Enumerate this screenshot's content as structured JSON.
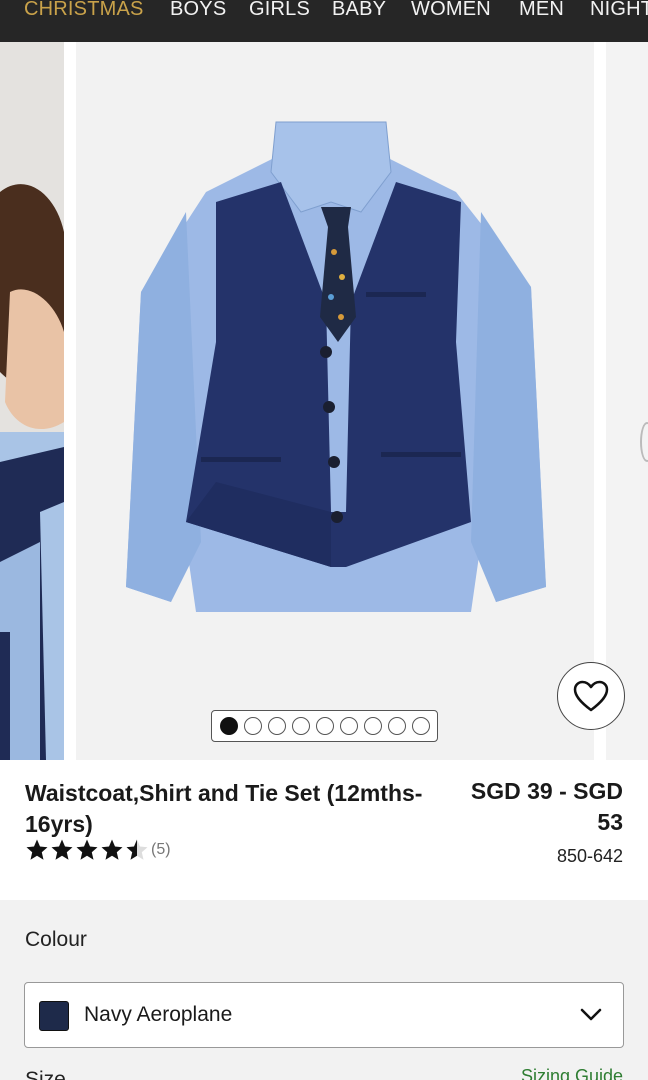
{
  "nav": {
    "items": [
      "CHRISTMAS",
      "BOYS",
      "GIRLS",
      "BABY",
      "WOMEN",
      "MEN",
      "NIGHT"
    ]
  },
  "gallery": {
    "slide_count": 9,
    "active_index": 0
  },
  "product": {
    "title": "Waistcoat,Shirt and Tie Set (12mths-16yrs)",
    "price": "SGD 39 - SGD 53",
    "item_number": "850-642",
    "rating": 4.5,
    "review_count": "(5)"
  },
  "colour": {
    "label": "Colour",
    "selected": "Navy Aeroplane",
    "swatch": "#1e2a4a"
  },
  "size": {
    "label": "Size",
    "guide_link": "Sizing Guide"
  },
  "colors": {
    "nav_bg": "#262626",
    "nav_gold": "#c9a24a",
    "link_green": "#2e7d32"
  },
  "icons": {
    "wishlist": "heart-icon",
    "dropdown": "chevron-down-icon",
    "star": "star-icon"
  }
}
